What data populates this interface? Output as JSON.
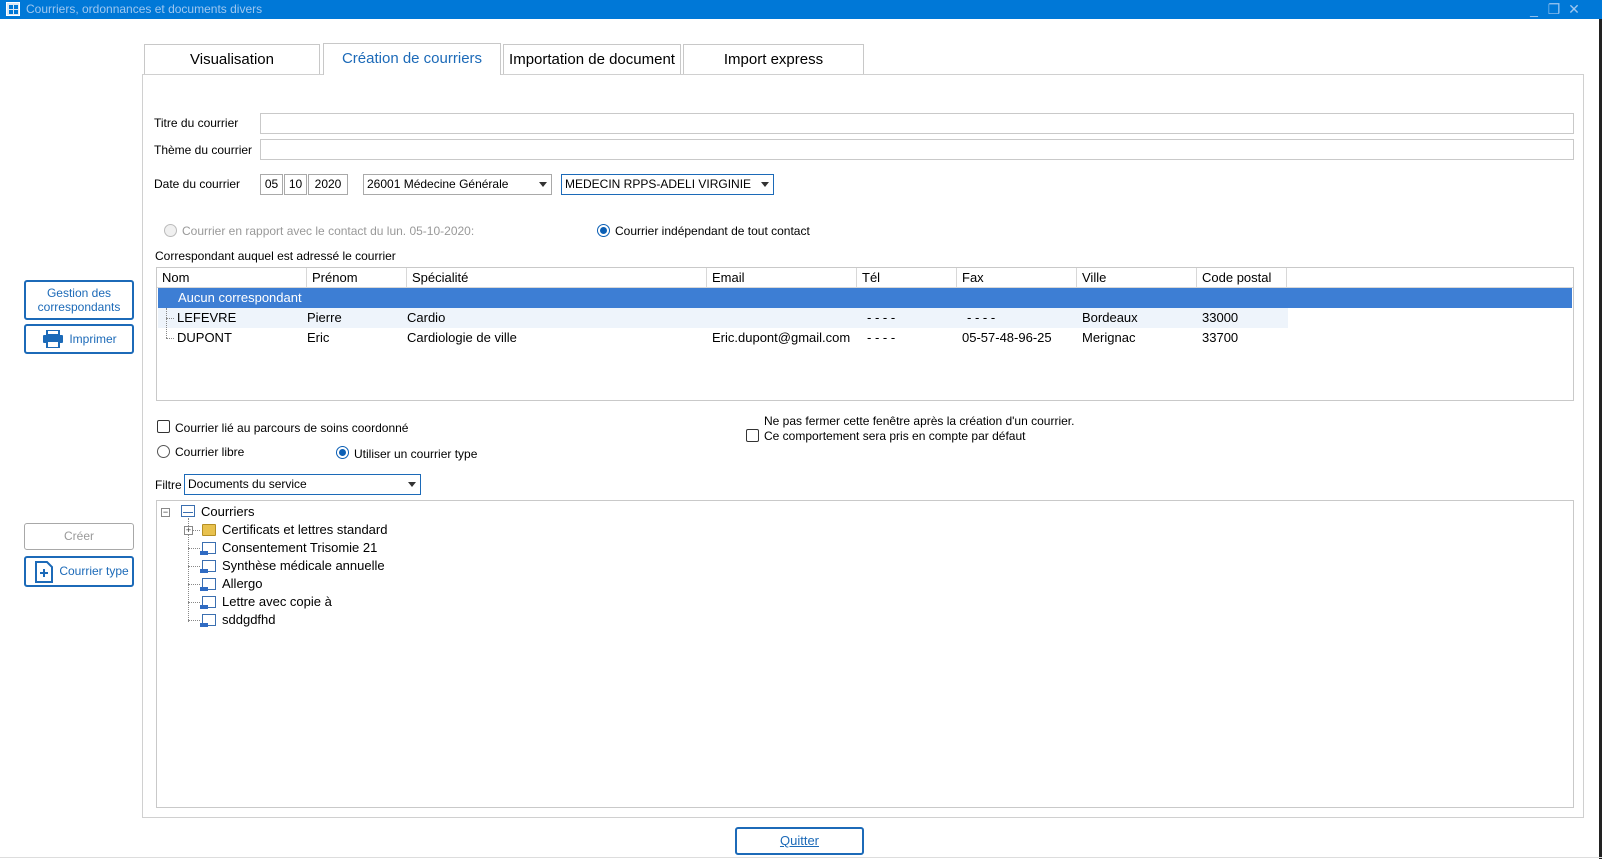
{
  "window": {
    "title": "Courriers, ordonnances et documents divers",
    "controls": [
      "_",
      "❐",
      "✕"
    ]
  },
  "tabs": [
    {
      "label": "Visualisation",
      "active": false
    },
    {
      "label": "Création de courriers",
      "active": true
    },
    {
      "label": "Importation de document",
      "active": false
    },
    {
      "label": "Import express",
      "active": false
    }
  ],
  "side_buttons": {
    "gestion_label": "Gestion des correspondants",
    "gestion_line1": "Gestion des",
    "gestion_line2": "correspondants",
    "imprimer_label": "Imprimer",
    "creer_label": "Créer",
    "courrier_type_label": "Courrier type"
  },
  "form": {
    "titre_label": "Titre du courrier",
    "titre_value": "",
    "theme_label": "Thème du courrier",
    "theme_value": "",
    "date_label": "Date du courrier",
    "date_day": "05",
    "date_month": "10",
    "date_year": "2020",
    "specialite_value": "26001 Médecine Générale",
    "medecin_value": "MEDECIN RPPS-ADELI VIRGINIE",
    "radio_contact_label": "Courrier en rapport avec le contact du lun. 05-10-2020:",
    "radio_independant_label": "Courrier indépendant de tout contact",
    "correspondant_heading": "Correspondant auquel est adressé le courrier"
  },
  "grid": {
    "columns": [
      "Nom",
      "Prénom",
      "Spécialité",
      "Email",
      "Tél",
      "Fax",
      "Ville",
      "Code postal"
    ],
    "selected_row": "Aucun correspondant",
    "rows": [
      {
        "nom": "LEFEVRE",
        "prenom": "Pierre",
        "specialite": "Cardio",
        "email": "",
        "tel": "- - - -",
        "fax": "- - - -",
        "ville": "Bordeaux",
        "cp": "33000"
      },
      {
        "nom": "DUPONT",
        "prenom": "Eric",
        "specialite": "Cardiologie de ville",
        "email": "Eric.dupont@gmail.com",
        "tel": "- - - -",
        "fax": "05-57-48-96-25",
        "ville": "Merignac",
        "cp": "33700"
      }
    ]
  },
  "options": {
    "parcours_label": "Courrier lié au parcours de soins coordonné",
    "libre_label": "Courrier libre",
    "type_label": "Utiliser un courrier type",
    "nepas_line1": "Ne pas fermer cette fenêtre après la création d'un courrier.",
    "nepas_line2": "Ce comportement sera pris en compte par défaut",
    "filtre_label": "Filtre",
    "filtre_value": "Documents du service"
  },
  "tree": {
    "root": "Courriers",
    "children": [
      {
        "label": "Certificats et lettres standard",
        "kind": "folder-icon",
        "expandable": true
      },
      {
        "label": "Consentement Trisomie 21",
        "kind": "document-icon"
      },
      {
        "label": "Synthèse médicale annuelle",
        "kind": "document-icon"
      },
      {
        "label": "Allergo",
        "kind": "document-icon"
      },
      {
        "label": "Lettre avec copie à",
        "kind": "document-icon"
      },
      {
        "label": "sddgdfhd",
        "kind": "document-icon"
      }
    ]
  },
  "quit_label": "Quitter",
  "colors": {
    "accent": "#0078d7",
    "link": "#1c6ab8",
    "selection": "#3d7ed4"
  }
}
